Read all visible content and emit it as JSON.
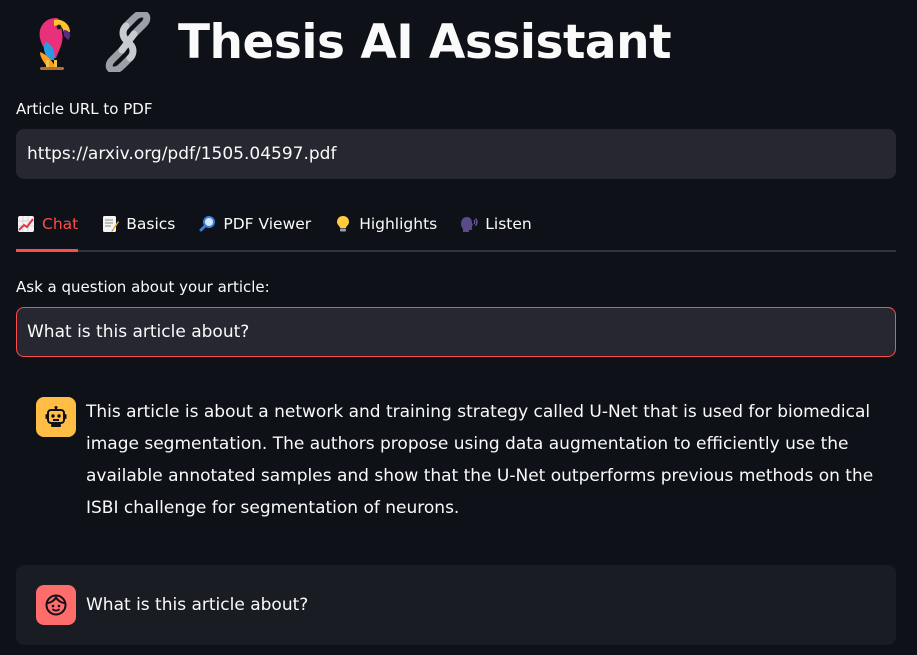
{
  "header": {
    "parrot_icon": "parrot-icon",
    "link_icon": "link-icon",
    "title": "Thesis AI Assistant"
  },
  "url_field": {
    "label": "Article URL to PDF",
    "value": "https://arxiv.org/pdf/1505.04597.pdf"
  },
  "tabs": [
    {
      "label": "Chat",
      "icon": "chart-increasing-icon",
      "active": true
    },
    {
      "label": "Basics",
      "icon": "memo-icon",
      "active": false
    },
    {
      "label": "PDF Viewer",
      "icon": "magnifier-icon",
      "active": false
    },
    {
      "label": "Highlights",
      "icon": "light-bulb-icon",
      "active": false
    },
    {
      "label": "Listen",
      "icon": "speaking-head-icon",
      "active": false
    }
  ],
  "question_field": {
    "label": "Ask a question about your article:",
    "value": "What is this article about?"
  },
  "messages": [
    {
      "role": "assistant",
      "avatar": "robot-icon",
      "text": "This article is about a network and training strategy called U-Net that is used for biomedical image segmentation. The authors propose using data augmentation to efficiently use the available annotated samples and show that the U-Net outperforms previous methods on the ISBI challenge for segmentation of neurons."
    },
    {
      "role": "user",
      "avatar": "face-icon",
      "text": "What is this article about?"
    }
  ],
  "colors": {
    "background": "#0e1117",
    "accent": "#ff4b4b",
    "input_bg": "#262730",
    "bot_avatar": "#ffbd45",
    "user_avatar": "#ff6c6c"
  }
}
